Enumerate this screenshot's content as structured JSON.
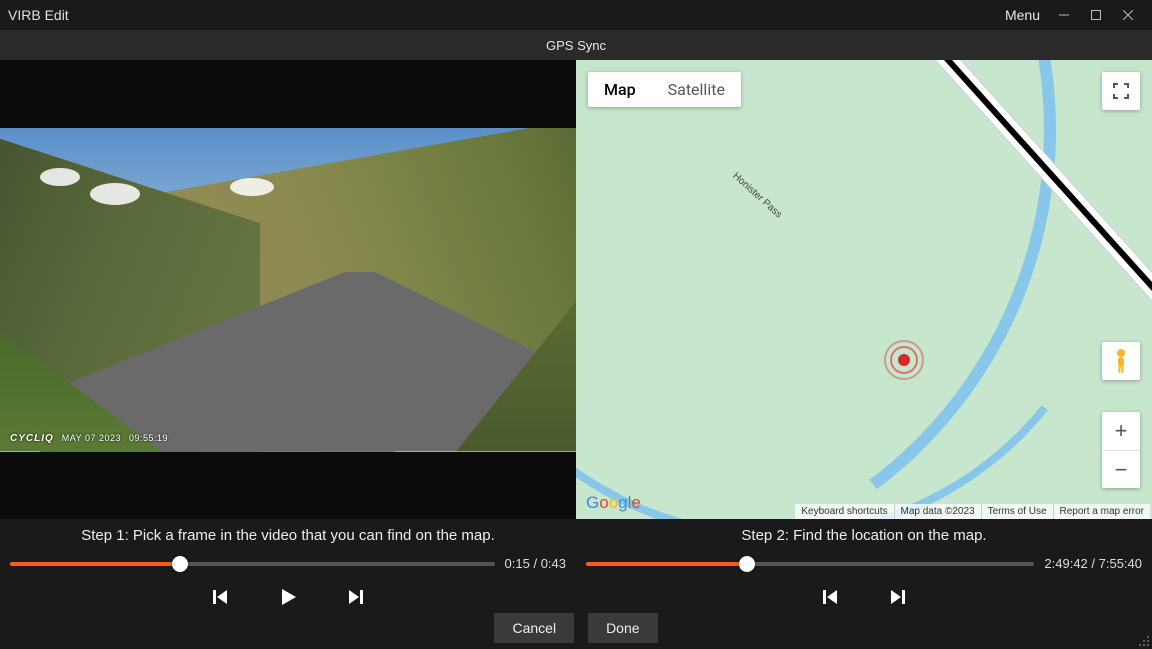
{
  "app": {
    "title": "VIRB Edit",
    "menu_label": "Menu"
  },
  "header": {
    "title": "GPS Sync"
  },
  "video": {
    "overlay_brand": "CYCLIQ",
    "overlay_date": "MAY 07 2023",
    "overlay_time": "09:55:19"
  },
  "map": {
    "type_map": "Map",
    "type_satellite": "Satellite",
    "road_label": "Honister Pass",
    "logo": "Google",
    "footer": {
      "shortcuts": "Keyboard shortcuts",
      "data": "Map data ©2023",
      "terms": "Terms of Use",
      "report": "Report a map error"
    }
  },
  "steps": {
    "step1": "Step 1: Pick a frame in the video that you can find on the map.",
    "step2": "Step 2: Find the location on the map."
  },
  "playback": {
    "video": {
      "current": "0:15",
      "total": "0:43",
      "progress_pct": 35
    },
    "gps": {
      "current": "2:49:42",
      "total": "7:55:40",
      "progress_pct": 36
    }
  },
  "actions": {
    "cancel": "Cancel",
    "done": "Done"
  }
}
